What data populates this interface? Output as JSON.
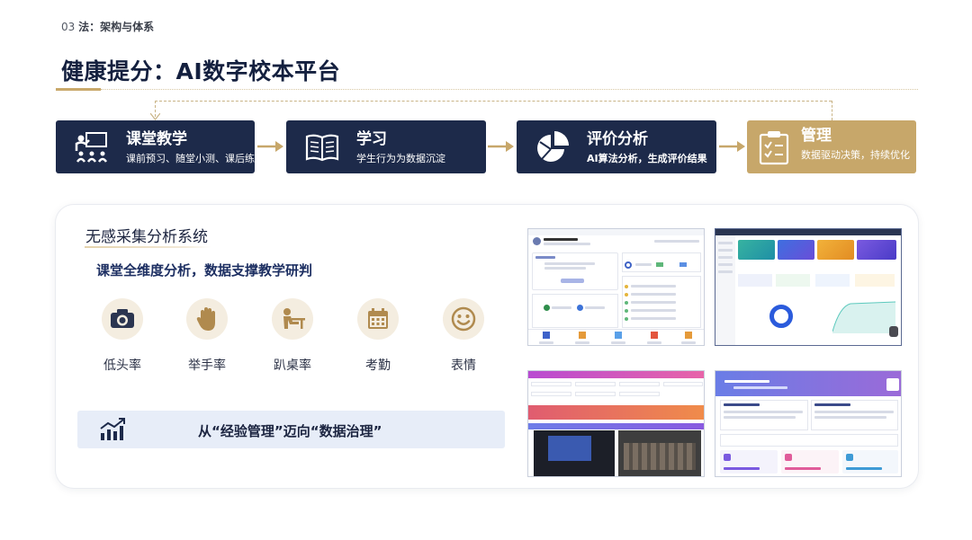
{
  "header": {
    "section_num": "03",
    "section_name": "法：架构与体系",
    "title": "健康提分：AI数字校本平台"
  },
  "flow": [
    {
      "title": "课堂教学",
      "sub": "课前预习、随堂小测、课后练习",
      "icon": "teacher-icon"
    },
    {
      "title": "学习",
      "sub": "学生行为为数据沉淀",
      "icon": "book-icon"
    },
    {
      "title": "评价分析",
      "sub": "AI算法分析，生成评价结果",
      "icon": "pie-chart-icon"
    },
    {
      "title": "管理",
      "sub": "数据驱动决策，持续优化",
      "icon": "clipboard-icon"
    }
  ],
  "card": {
    "heading": "无感采集分析系统",
    "subheading": "课堂全维度分析，数据支撑教学研判",
    "metrics": [
      {
        "label": "低头率",
        "icon": "camera-icon"
      },
      {
        "label": "举手率",
        "icon": "hand-icon"
      },
      {
        "label": "趴桌率",
        "icon": "desk-icon"
      },
      {
        "label": "考勤",
        "icon": "calendar-icon"
      },
      {
        "label": "表情",
        "icon": "smile-icon"
      }
    ],
    "banner": "从“经验管理”迈向“数据治理”"
  },
  "colors": {
    "navy": "#1d2a4a",
    "gold": "#c7a76a",
    "gold_light": "#f4ede0"
  }
}
